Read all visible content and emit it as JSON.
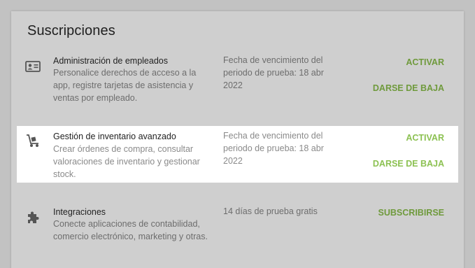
{
  "title": "Suscripciones",
  "subscriptions": [
    {
      "icon": "id-card-icon",
      "name": "Administración de empleados",
      "description": "Personalice derechos de acceso a la app, registre tarjetas de asistencia y ventas por empleado.",
      "status": "Fecha de vencimiento del periodo de prueba: 18 abr 2022",
      "actions": [
        "ACTIVAR",
        "DARSE DE BAJA"
      ]
    },
    {
      "icon": "hand-truck-icon",
      "name": "Gestión de inventario avanzado",
      "description": "Crear órdenes de compra, consultar valoraciones de inventario y gestionar stock.",
      "status": "Fecha de vencimiento del periodo de prueba: 18 abr 2022",
      "actions": [
        "ACTIVAR",
        "DARSE DE BAJA"
      ]
    },
    {
      "icon": "puzzle-icon",
      "name": "Integraciones",
      "description": "Conecte aplicaciones de contabilidad, comercio electrónico, marketing y otras.",
      "status": "14 días de prueba gratis",
      "actions": [
        "SUBSCRIBIRSE"
      ]
    }
  ],
  "colors": {
    "accent_green": "#8cc152",
    "highlight_border": "#f0852d"
  }
}
